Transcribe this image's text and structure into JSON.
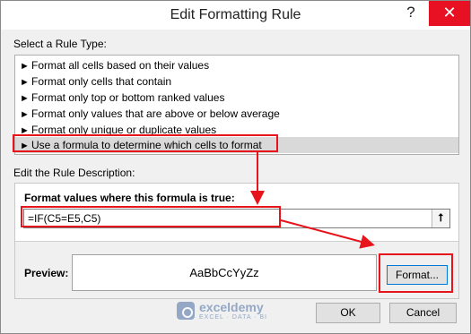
{
  "dialog": {
    "title": "Edit Formatting Rule",
    "help_glyph": "?",
    "close_glyph": "✕"
  },
  "rule_type": {
    "label": "Select a Rule Type:",
    "items": [
      {
        "label": "Format all cells based on their values"
      },
      {
        "label": "Format only cells that contain"
      },
      {
        "label": "Format only top or bottom ranked values"
      },
      {
        "label": "Format only values that are above or below average"
      },
      {
        "label": "Format only unique or duplicate values"
      },
      {
        "label": "Use a formula to determine which cells to format",
        "selected": true
      }
    ],
    "item_arrow": "►"
  },
  "description": {
    "label": "Edit the Rule Description:",
    "formula_label": "Format values where this formula is true:",
    "formula_value": "=IF(C5=E5,C5)",
    "collapse_glyph": "⭡",
    "preview_label": "Preview:",
    "preview_text": "AaBbCcYyZz",
    "format_button": "Format..."
  },
  "buttons": {
    "ok": "OK",
    "cancel": "Cancel"
  },
  "watermark": {
    "name": "exceldemy",
    "tagline": "EXCEL · DATA · BI"
  },
  "colors": {
    "accent_red": "#e8141b",
    "close_red": "#e81123",
    "selected_row": "#d9d9d9"
  }
}
